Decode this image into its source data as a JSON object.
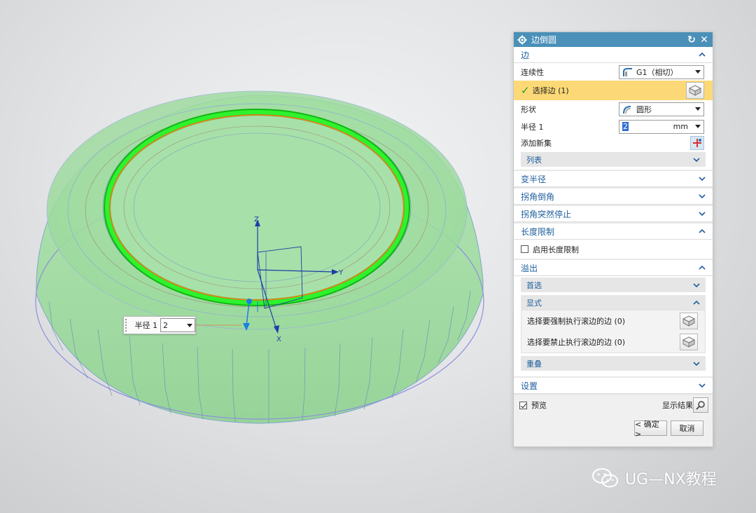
{
  "viewport": {
    "axis_labels": {
      "z": "Z",
      "y": "Y",
      "x": "X"
    },
    "float_input": {
      "label": "半径 1",
      "value": "2"
    }
  },
  "dialog": {
    "title": "边倒圆",
    "edge_section": {
      "title": "边",
      "continuity_label": "连续性",
      "continuity_value": "G1（相切）",
      "select_edge_label": "选择边 (1)",
      "shape_label": "形状",
      "shape_value": "圆形",
      "radius_label": "半径 1",
      "radius_value": "2",
      "radius_unit": "mm",
      "add_set_label": "添加新集",
      "list_label": "列表"
    },
    "variable_radius": {
      "title": "变半径"
    },
    "corner_setback": {
      "title": "拐角倒角"
    },
    "corner_stop": {
      "title": "拐角突然停止"
    },
    "length_limit": {
      "title": "长度限制",
      "enable_label": "启用长度限制",
      "enabled": false
    },
    "overflow": {
      "title": "溢出",
      "preferred_label": "首选",
      "explicit_label": "显式",
      "force_roll_label": "选择要强制执行滚边的边 (0)",
      "forbid_roll_label": "选择要禁止执行滚边的边 (0)",
      "overlap_label": "重叠"
    },
    "settings": {
      "title": "设置"
    },
    "footer": {
      "preview_label": "预览",
      "preview_checked": true,
      "show_result_label": "显示结果",
      "ok_label": "< 确定 >",
      "cancel_label": "取消"
    }
  },
  "watermark": {
    "text": "UG—NX教程"
  },
  "colors": {
    "title_bar": "#4a90b8",
    "section_header_text": "#1f5f9e",
    "selection_highlight": "#fcd976",
    "model_fill": "#a5dea6",
    "selected_edge": "#29e029"
  }
}
